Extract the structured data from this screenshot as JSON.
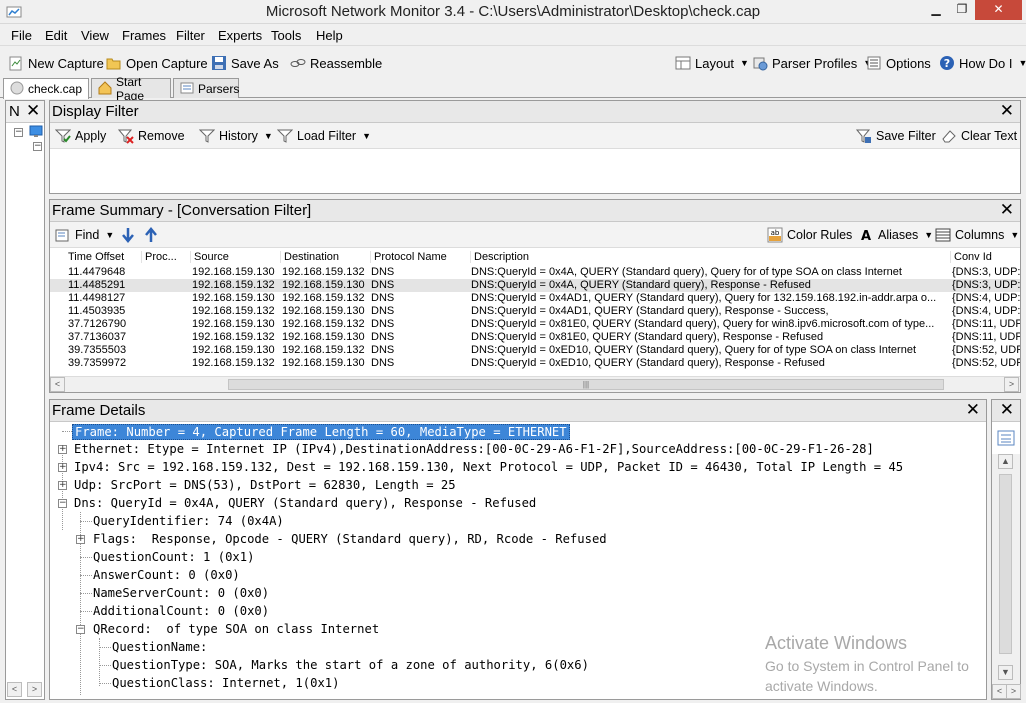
{
  "window": {
    "title": "Microsoft Network Monitor 3.4 - C:\\Users\\Administrator\\Desktop\\check.cap"
  },
  "menu": [
    "File",
    "Edit",
    "View",
    "Frames",
    "Filter",
    "Experts",
    "Tools",
    "Help"
  ],
  "toolbar": {
    "new_capture": "New Capture",
    "open_capture": "Open Capture",
    "save_as": "Save As",
    "reassemble": "Reassemble",
    "layout": "Layout",
    "parser_profiles": "Parser Profiles",
    "options": "Options",
    "how_do_i": "How Do I"
  },
  "tabs": [
    "check.cap",
    "Start Page",
    "Parsers"
  ],
  "left_pane": {
    "header": "N"
  },
  "display_filter": {
    "title": "Display Filter",
    "apply": "Apply",
    "remove": "Remove",
    "history": "History",
    "load_filter": "Load Filter",
    "save_filter": "Save Filter",
    "clear_text": "Clear Text"
  },
  "frame_summary": {
    "title": "Frame Summary - [Conversation Filter]",
    "find": "Find",
    "color_rules": "Color Rules",
    "aliases": "Aliases",
    "columns_label": "Columns",
    "columns": [
      "Time Offset",
      "Proc...",
      "Source",
      "Destination",
      "Protocol Name",
      "Description",
      "Conv Id"
    ],
    "rows": [
      [
        "11.4479648",
        "",
        "192.168.159.130",
        "192.168.159.132",
        "DNS",
        "DNS:QueryId = 0x4A, QUERY (Standard query), Query  for  of type SOA on class Internet",
        "{DNS:3, UDP:"
      ],
      [
        "11.4485291",
        "",
        "192.168.159.132",
        "192.168.159.130",
        "DNS",
        "DNS:QueryId = 0x4A, QUERY (Standard query), Response - Refused",
        "{DNS:3, UDP:"
      ],
      [
        "11.4498127",
        "",
        "192.168.159.130",
        "192.168.159.132",
        "DNS",
        "DNS:QueryId = 0x4AD1, QUERY (Standard query), Query  for 132.159.168.192.in-addr.arpa o...",
        "{DNS:4, UDP:"
      ],
      [
        "11.4503935",
        "",
        "192.168.159.132",
        "192.168.159.130",
        "DNS",
        "DNS:QueryId = 0x4AD1, QUERY (Standard query), Response - Success,",
        "{DNS:4, UDP:"
      ],
      [
        "37.7126790",
        "",
        "192.168.159.130",
        "192.168.159.132",
        "DNS",
        "DNS:QueryId = 0x81E0, QUERY (Standard query), Query  for win8.ipv6.microsoft.com of type...",
        "{DNS:11, UDP"
      ],
      [
        "37.7136037",
        "",
        "192.168.159.132",
        "192.168.159.130",
        "DNS",
        "DNS:QueryId = 0x81E0, QUERY (Standard query), Response - Refused",
        "{DNS:11, UDP"
      ],
      [
        "39.7355503",
        "",
        "192.168.159.130",
        "192.168.159.132",
        "DNS",
        "DNS:QueryId = 0xED10, QUERY (Standard query), Query  for  of type SOA on class Internet",
        "{DNS:52, UDP"
      ],
      [
        "39.7359972",
        "",
        "192.168.159.132",
        "192.168.159.130",
        "DNS",
        "DNS:QueryId = 0xED10, QUERY (Standard query), Response - Refused",
        "{DNS:52, UDP"
      ]
    ]
  },
  "frame_details": {
    "title": "Frame Details",
    "lines": [
      "Frame: Number = 4, Captured Frame Length = 60, MediaType = ETHERNET",
      "Ethernet: Etype = Internet IP (IPv4),DestinationAddress:[00-0C-29-A6-F1-2F],SourceAddress:[00-0C-29-F1-26-28]",
      "Ipv4: Src = 192.168.159.132, Dest = 192.168.159.130, Next Protocol = UDP, Packet ID = 46430, Total IP Length = 45",
      "Udp: SrcPort = DNS(53), DstPort = 62830, Length = 25",
      "Dns: QueryId = 0x4A, QUERY (Standard query), Response - Refused",
      "QueryIdentifier: 74 (0x4A)",
      "Flags:  Response, Opcode - QUERY (Standard query), RD, Rcode - Refused",
      "QuestionCount: 1 (0x1)",
      "AnswerCount: 0 (0x0)",
      "NameServerCount: 0 (0x0)",
      "AdditionalCount: 0 (0x0)",
      "QRecord:  of type SOA on class Internet",
      "QuestionName:",
      "QuestionType: SOA, Marks the start of a zone of authority, 6(0x6)",
      "QuestionClass: Internet, 1(0x1)"
    ]
  },
  "watermark": {
    "title": "Activate Windows",
    "line1": "Go to System in Control Panel to",
    "line2": "activate Windows."
  }
}
